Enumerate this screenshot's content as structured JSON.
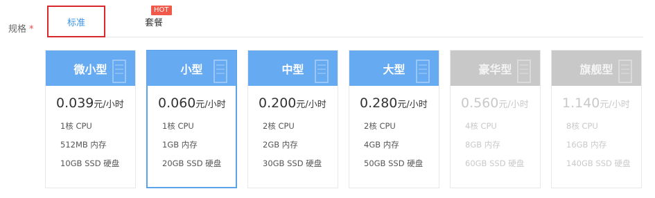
{
  "form": {
    "label": "规格",
    "required_mark": "*"
  },
  "tabs": {
    "standard": "标准",
    "package": "套餐",
    "hot_badge": "HOT"
  },
  "unit": "元/小时",
  "cards": [
    {
      "name": "微小型",
      "price": "0.039",
      "cpu": "1核 CPU",
      "memory": "512MB 内存",
      "disk": "10GB SSD 硬盘",
      "state": "available"
    },
    {
      "name": "小型",
      "price": "0.060",
      "cpu": "1核 CPU",
      "memory": "1GB 内存",
      "disk": "20GB SSD 硬盘",
      "state": "selected"
    },
    {
      "name": "中型",
      "price": "0.200",
      "cpu": "2核 CPU",
      "memory": "2GB 内存",
      "disk": "30GB SSD 硬盘",
      "state": "available"
    },
    {
      "name": "大型",
      "price": "0.280",
      "cpu": "2核 CPU",
      "memory": "4GB 内存",
      "disk": "50GB SSD 硬盘",
      "state": "available"
    },
    {
      "name": "豪华型",
      "price": "0.560",
      "cpu": "4核 CPU",
      "memory": "8GB 内存",
      "disk": "60GB SSD 硬盘",
      "state": "disabled"
    },
    {
      "name": "旗舰型",
      "price": "1.140",
      "cpu": "8核 CPU",
      "memory": "16GB 内存",
      "disk": "140GB SSD 硬盘",
      "state": "disabled"
    }
  ],
  "colors": {
    "header_blue": "#66aaf1",
    "header_disabled": "#c8c8c8",
    "selected_border": "#5aa3e8",
    "tab_highlight_border": "#d9282c",
    "hot_badge": "#f15a4a"
  },
  "icons": {
    "card_decoration": "server-rack-icon"
  }
}
